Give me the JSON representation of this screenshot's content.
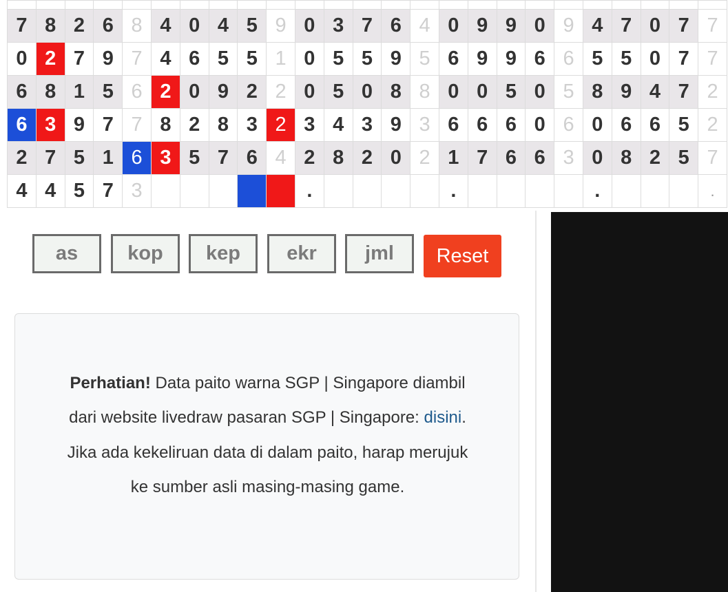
{
  "paito": {
    "rows": [
      [
        "7",
        "8",
        "2",
        "6",
        "8",
        "4",
        "0",
        "4",
        "5",
        "9",
        "0",
        "3",
        "7",
        "6",
        "4",
        "0",
        "9",
        "9",
        "0",
        "9",
        "4",
        "7",
        "0",
        "7",
        "7"
      ],
      [
        "0",
        "2",
        "7",
        "9",
        "7",
        "4",
        "6",
        "5",
        "5",
        "1",
        "0",
        "5",
        "5",
        "9",
        "5",
        "6",
        "9",
        "9",
        "6",
        "6",
        "5",
        "5",
        "0",
        "7",
        "7"
      ],
      [
        "6",
        "8",
        "1",
        "5",
        "6",
        "2",
        "0",
        "9",
        "2",
        "2",
        "0",
        "5",
        "0",
        "8",
        "8",
        "0",
        "0",
        "5",
        "0",
        "5",
        "8",
        "9",
        "4",
        "7",
        "2"
      ],
      [
        "6",
        "3",
        "9",
        "7",
        "7",
        "8",
        "2",
        "8",
        "3",
        "2",
        "3",
        "4",
        "3",
        "9",
        "3",
        "6",
        "6",
        "6",
        "0",
        "6",
        "0",
        "6",
        "6",
        "5",
        "2"
      ],
      [
        "2",
        "7",
        "5",
        "1",
        "6",
        "3",
        "5",
        "7",
        "6",
        "4",
        "2",
        "8",
        "2",
        "0",
        "2",
        "1",
        "7",
        "6",
        "6",
        "3",
        "0",
        "8",
        "2",
        "5",
        "7"
      ],
      [
        "4",
        "4",
        "5",
        "7",
        "3",
        "",
        "",
        "",
        "",
        "",
        ".",
        "",
        "",
        "",
        "",
        "",
        ".",
        "",
        "",
        "",
        "",
        "",
        ".",
        "",
        "",
        "",
        "",
        "."
      ]
    ],
    "last_row": [
      "4",
      "4",
      "5",
      "7",
      "3",
      "",
      "",
      "",
      "",
      "",
      ".",
      "",
      "",
      "",
      "",
      ".",
      "",
      "",
      "",
      "",
      ".",
      "",
      "",
      "",
      "."
    ]
  },
  "buttons": {
    "as": "as",
    "kop": "kop",
    "kep": "kep",
    "ekr": "ekr",
    "jml": "jml",
    "reset": "Reset"
  },
  "notice": {
    "bold": "Perhatian!",
    "text_before_link": " Data paito warna SGP | Singapore diambil dari website livedraw pasaran SGP | Singapore: ",
    "link": "disini",
    "text_after_link": ". Jika ada kekeliruan data di dalam paito, harap merujuk ke sumber asli masing-masing game."
  },
  "colors": {
    "highlight_red": "#f01818",
    "highlight_blue": "#1c4fd8",
    "reset_button": "#f0401f",
    "link": "#1e5a8c"
  }
}
